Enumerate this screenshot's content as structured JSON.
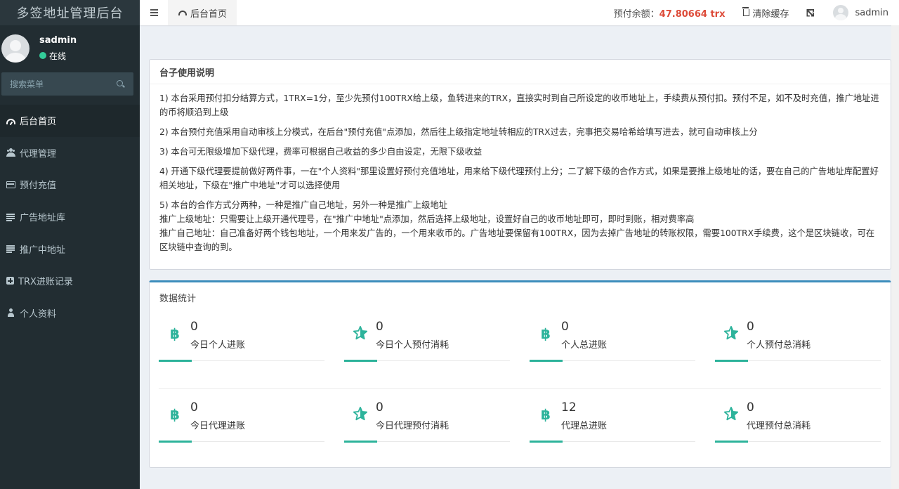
{
  "brand": "多签地址管理后台",
  "user": {
    "name": "sadmin",
    "status": "在线"
  },
  "search": {
    "placeholder": "搜索菜单"
  },
  "menu": [
    {
      "label": "后台首页",
      "icon": "dashboard-icon",
      "active": true
    },
    {
      "label": "代理管理",
      "icon": "users-icon"
    },
    {
      "label": "预付充值",
      "icon": "credit-card-icon"
    },
    {
      "label": "广告地址库",
      "icon": "list-icon"
    },
    {
      "label": "推广中地址",
      "icon": "list-icon"
    },
    {
      "label": "TRX进账记录",
      "icon": "plus-square-icon"
    },
    {
      "label": "个人资料",
      "icon": "user-icon"
    }
  ],
  "header": {
    "tab_label": "后台首页",
    "balance_label": "预付余额：",
    "balance_value": "47.80664 trx",
    "clear_cache": "清除缓存",
    "username": "sadmin"
  },
  "info": {
    "title": "台子使用说明",
    "paragraphs": [
      [
        "1) 本台采用预付扣分结算方式，1TRX=1分，至少先预付100TRX给上级，鱼转进来的TRX，直接实时到自己所设定的收币地址上，手续费从预付扣。预付不足，如不及时充值，推广地址进的币将顺沿到上级"
      ],
      [
        "2) 本台预付充值采用自动审核上分模式，在后台\"预付充值\"点添加，然后往上级指定地址转相应的TRX过去，完事把交易哈希给填写进去，就可自动审核上分"
      ],
      [
        "3) 本台可无限级增加下级代理，费率可根据自己收益的多少自由设定，无限下级收益"
      ],
      [
        "4) 开通下级代理要提前做好两件事，一在\"个人资料\"那里设置好预付充值地址，用来给下级代理预付上分；二了解下级的合作方式，如果是要推上级地址的话，要在自己的广告地址库配置好相关地址，下级在\"推广中地址\"才可以选择使用"
      ],
      [
        "5) 本台的合作方式分两种，一种是推广自己地址，另外一种是推广上级地址",
        "推广上级地址：只需要让上级开通代理号，在\"推广中地址\"点添加，然后选择上级地址，设置好自己的收币地址即可，即时到账，相对费率高",
        "推广自己地址：自己准备好两个钱包地址，一个用来发广告的，一个用来收币的。广告地址要保留有100TRX，因为去掉广告地址的转账权限，需要100TRX手续费，这个是区块链收，可在区块链中查询的到。"
      ]
    ]
  },
  "stats": {
    "title": "数据统计",
    "accent_color": "#2db39b",
    "items": [
      {
        "value": "0",
        "label": "今日个人进账",
        "icon": "bitcoin-icon"
      },
      {
        "value": "0",
        "label": "今日个人预付消耗",
        "icon": "star-icon"
      },
      {
        "value": "0",
        "label": "个人总进账",
        "icon": "bitcoin-icon"
      },
      {
        "value": "0",
        "label": "个人预付总消耗",
        "icon": "star-icon"
      },
      {
        "value": "0",
        "label": "今日代理进账",
        "icon": "bitcoin-icon"
      },
      {
        "value": "0",
        "label": "今日代理预付消耗",
        "icon": "star-icon"
      },
      {
        "value": "12",
        "label": "代理总进账",
        "icon": "bitcoin-icon"
      },
      {
        "value": "0",
        "label": "代理预付总消耗",
        "icon": "star-icon"
      }
    ]
  }
}
